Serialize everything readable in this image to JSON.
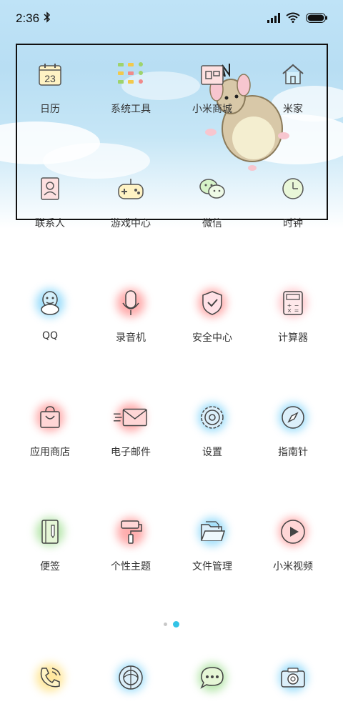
{
  "status_bar": {
    "time": "2:36",
    "icons": [
      "bluetooth-icon",
      "signal-icon",
      "wifi-icon",
      "battery-icon"
    ]
  },
  "page1": {
    "apps": [
      {
        "label": "日历",
        "icon": "calendar-icon",
        "day": "23"
      },
      {
        "label": "系统工具",
        "icon": "folder-icon"
      },
      {
        "label": "小米商城",
        "icon": "mi-store-icon"
      },
      {
        "label": "米家",
        "icon": "home-icon"
      },
      {
        "label": "联系人",
        "icon": "contacts-icon"
      },
      {
        "label": "游戏中心",
        "icon": "gamepad-icon"
      },
      {
        "label": "微信",
        "icon": "wechat-icon"
      },
      {
        "label": "时钟",
        "icon": "clock-icon"
      }
    ]
  },
  "page2": {
    "apps": [
      {
        "label": "QQ",
        "icon": "qq-icon"
      },
      {
        "label": "录音机",
        "icon": "microphone-icon"
      },
      {
        "label": "安全中心",
        "icon": "shield-icon"
      },
      {
        "label": "计算器",
        "icon": "calculator-icon"
      },
      {
        "label": "应用商店",
        "icon": "shopping-bag-icon"
      },
      {
        "label": "电子邮件",
        "icon": "mail-icon"
      },
      {
        "label": "设置",
        "icon": "gear-icon"
      },
      {
        "label": "指南针",
        "icon": "compass-icon"
      },
      {
        "label": "便签",
        "icon": "notepad-icon"
      },
      {
        "label": "个性主题",
        "icon": "paint-roller-icon"
      },
      {
        "label": "文件管理",
        "icon": "file-manager-icon"
      },
      {
        "label": "小米视频",
        "icon": "play-icon"
      }
    ]
  },
  "pager": {
    "count": 2,
    "active": 2
  },
  "dock": {
    "apps": [
      {
        "icon": "phone-icon"
      },
      {
        "icon": "browser-icon"
      },
      {
        "icon": "messages-icon"
      },
      {
        "icon": "camera-icon"
      }
    ]
  },
  "colors": {
    "accent_dot": "#33c3e6",
    "sky_top": "#bfe3f7",
    "glow_blue": "#4fc3f7",
    "glow_red": "#ff6b6b",
    "glow_green": "#7fd36b",
    "glow_yellow": "#ffd54f"
  }
}
